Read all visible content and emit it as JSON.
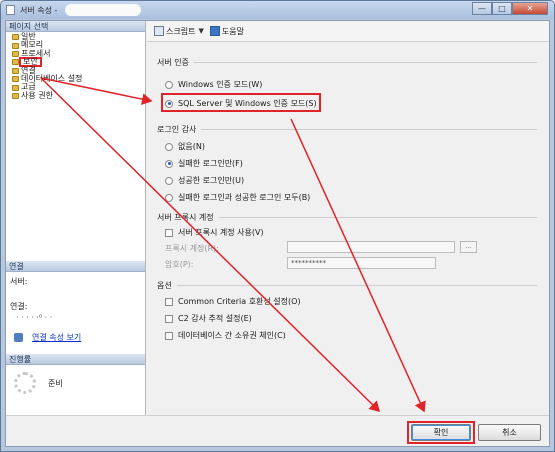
{
  "window": {
    "title": "서버 속성 -"
  },
  "sidebar": {
    "header": "페이지 선택",
    "items": [
      {
        "label": "일반"
      },
      {
        "label": "메모리"
      },
      {
        "label": "프로세서"
      },
      {
        "label": "보안"
      },
      {
        "label": "연결"
      },
      {
        "label": "데이터베이스 설정"
      },
      {
        "label": "고급"
      },
      {
        "label": "사용 권한"
      }
    ],
    "connection_header": "연결",
    "server_label": "서버:",
    "connection_label": "연결:",
    "connection_value": "· · ·  ·  ·⁰  ·  ·",
    "view_connection_link": "연결 속성 보기",
    "progress_header": "진행률",
    "progress_status": "준비"
  },
  "toolbar": {
    "script_label": "스크립트",
    "help_label": "도움말"
  },
  "server_auth": {
    "title": "서버 인증",
    "option_windows": "Windows 인증 모드(W)",
    "option_mixed": "SQL Server 및 Windows 인증 모드(S)",
    "selected": "mixed"
  },
  "login_audit": {
    "title": "로그인 감사",
    "options": [
      {
        "label": "없음(N)",
        "checked": false
      },
      {
        "label": "실패한 로그인만(F)",
        "checked": true
      },
      {
        "label": "성공한 로그인만(U)",
        "checked": false
      },
      {
        "label": "실패한 로그인과 성공한 로그인 모두(B)",
        "checked": false
      }
    ]
  },
  "proxy": {
    "title": "서버 프록시 계정",
    "enable_label": "서버 프록시 계정 사용(V)",
    "account_label": "프록시 계정(R):",
    "password_label": "암호(P):",
    "password_value": "**********",
    "browse_label": "..."
  },
  "options": {
    "title": "옵션",
    "items": [
      {
        "label": "Common Criteria 호환성 설정(O)"
      },
      {
        "label": "C2 감사 추적 설정(E)"
      },
      {
        "label": "데이터베이스 간 소유권 체인(C)"
      }
    ]
  },
  "buttons": {
    "ok": "확인",
    "cancel": "취소"
  },
  "colors": {
    "annotation": "#e0242a",
    "title_bar": "#a9c0de",
    "link": "#0033cc"
  }
}
